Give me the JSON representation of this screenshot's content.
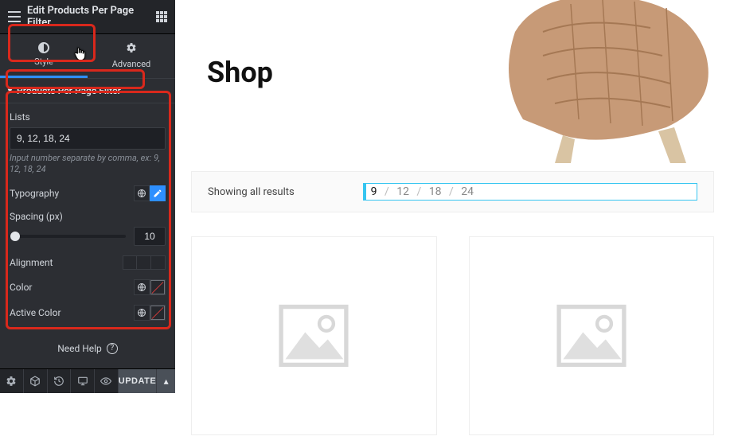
{
  "header": {
    "title": "Edit Products Per Page Filter"
  },
  "tabs": {
    "style": "Style",
    "advanced": "Advanced"
  },
  "panel": {
    "title": "Products Per Page Filter",
    "lists_label": "Lists",
    "lists_value": "9, 12, 18, 24",
    "lists_hint": "Input number separate by comma, ex: 9, 12, 18, 24",
    "typography_label": "Typography",
    "spacing_label": "Spacing (px)",
    "spacing_value": "10",
    "alignment_label": "Alignment",
    "color_label": "Color",
    "active_color_label": "Active Color"
  },
  "help": {
    "label": "Need Help"
  },
  "bottom": {
    "update": "UPDATE"
  },
  "preview": {
    "title": "Shop",
    "showing": "Showing all results",
    "ppp_options": [
      "9",
      "12",
      "18",
      "24"
    ],
    "ppp_sep": "/",
    "ppp_active": "9"
  }
}
